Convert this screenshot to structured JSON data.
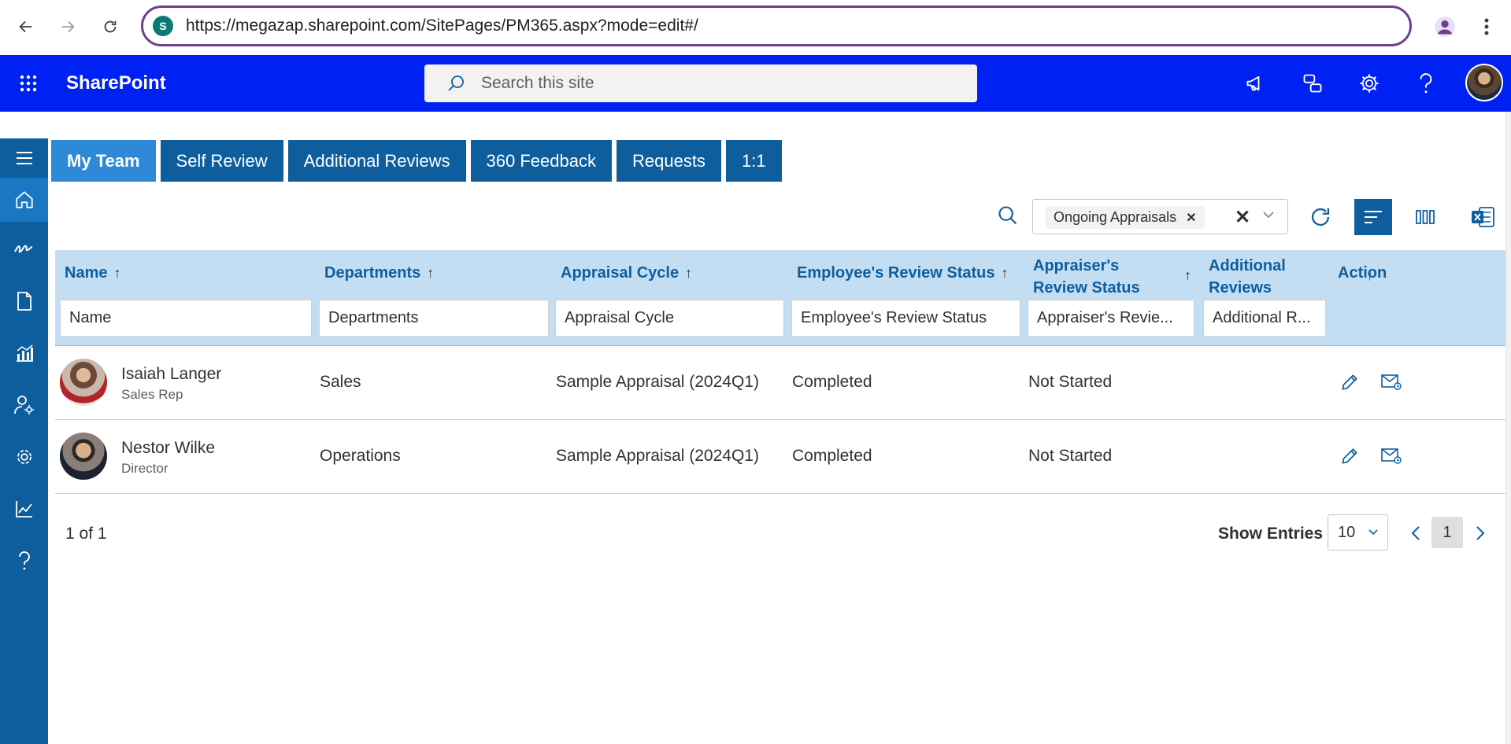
{
  "browser": {
    "url": "https://megazap.sharepoint.com/SitePages/PM365.aspx?mode=edit#/"
  },
  "sharepoint": {
    "title": "SharePoint",
    "search_placeholder": "Search this site"
  },
  "tabs": [
    {
      "label": "My Team",
      "active": true
    },
    {
      "label": "Self Review"
    },
    {
      "label": "Additional Reviews"
    },
    {
      "label": "360 Feedback"
    },
    {
      "label": "Requests"
    },
    {
      "label": "1:1"
    }
  ],
  "filter": {
    "chip": "Ongoing Appraisals"
  },
  "columns": [
    {
      "title": "Name",
      "filter": "Name"
    },
    {
      "title": "Departments",
      "filter": "Departments"
    },
    {
      "title": "Appraisal Cycle",
      "filter": "Appraisal Cycle"
    },
    {
      "title": "Employee's Review Status",
      "filter": "Employee's Review Status"
    },
    {
      "title_line1": "Appraiser's",
      "title_line2": "Review Status",
      "filter": "Appraiser's Revie..."
    },
    {
      "title_line1": "Additional",
      "title_line2": "Reviews",
      "filter": "Additional R..."
    },
    {
      "title": "Action"
    }
  ],
  "rows": [
    {
      "name": "Isaiah Langer",
      "title": "Sales Rep",
      "department": "Sales",
      "cycle": "Sample Appraisal (2024Q1)",
      "employee_status": "Completed",
      "appraiser_status": "Not Started"
    },
    {
      "name": "Nestor Wilke",
      "title": "Director",
      "department": "Operations",
      "cycle": "Sample Appraisal (2024Q1)",
      "employee_status": "Completed",
      "appraiser_status": "Not Started"
    }
  ],
  "pager": {
    "count": "1 of 1",
    "show_label": "Show Entries",
    "page_size": "10",
    "current_page": "1"
  },
  "icons": {
    "sort": "↑"
  },
  "colors": {
    "suite_bar": "#0021f3",
    "nav": "#0e5e9e",
    "active_tab": "#2e8ad6",
    "header_bg": "#c3def3"
  }
}
